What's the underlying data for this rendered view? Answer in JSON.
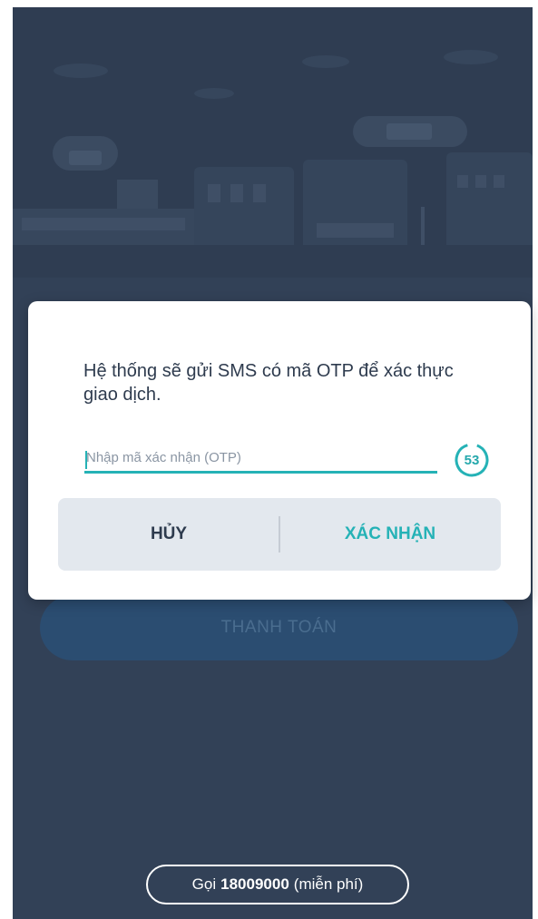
{
  "dialog": {
    "message": "Hệ thống sẽ gửi SMS có mã OTP để xác thực giao dịch.",
    "otp_placeholder": "Nhập mã xác nhận (OTP)",
    "otp_value": "",
    "countdown": "53",
    "cancel_label": "HỦY",
    "confirm_label": "XÁC NHẬN"
  },
  "background": {
    "pay_button_label": "THANH TOÁN",
    "call": {
      "prefix": "Gọi",
      "number": "18009000",
      "suffix": "(miễn phí)"
    }
  },
  "colors": {
    "overlay": "#324157",
    "accent": "#25b2b6",
    "dialog_bg": "#ffffff",
    "action_bar_bg": "#e3e8ee"
  }
}
